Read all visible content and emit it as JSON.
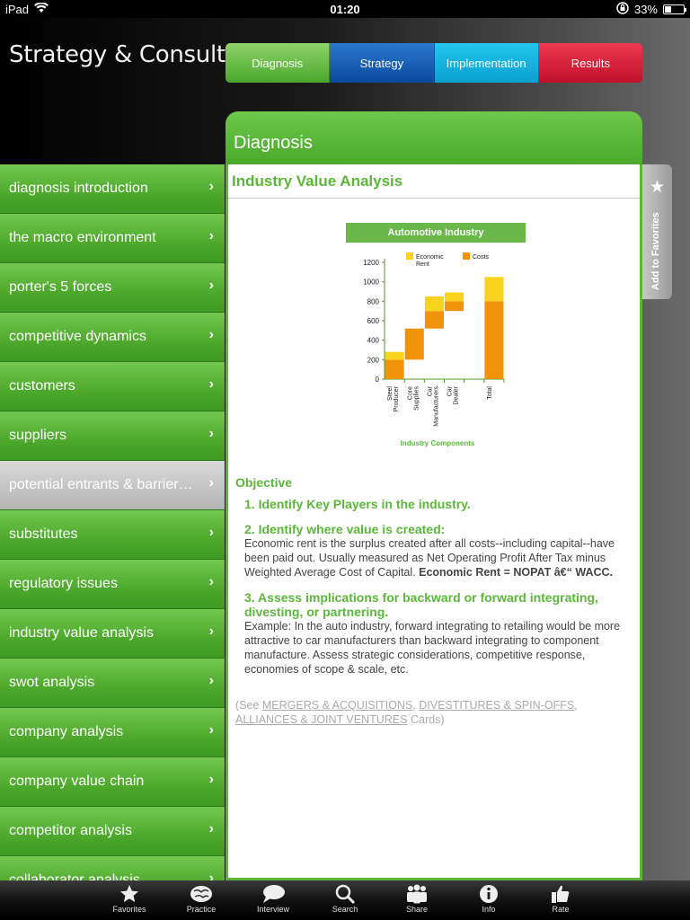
{
  "status": {
    "device": "iPad",
    "time": "01:20",
    "battery": "33%",
    "battery_fraction": 0.33
  },
  "header": {
    "title": "Strategy & Consulting"
  },
  "top_tabs": [
    {
      "label": "Diagnosis"
    },
    {
      "label": "Strategy"
    },
    {
      "label": "Implementation"
    },
    {
      "label": "Results"
    }
  ],
  "panel": {
    "title": "Diagnosis",
    "section_title": "Industry Value Analysis",
    "objective_heading": "Objective",
    "point1_title": "1. Identify Key Players in the industry.",
    "point2_title": "2. Identify where value is created:",
    "point2_text": "Economic rent is the surplus created after all costs--including capital--have been paid out. Usually measured as Net Operating Profit After Tax minus Weighted Average Cost of Capital.",
    "point2_bold": "Economic Rent = NOPAT â€“ WACC.",
    "point3_title": "3. Assess implications for backward or forward integrating, divesting, or partnering.",
    "point3_text": "Example: In the auto industry, forward integrating to retailing would be more attractive to car manufacturers than backward integrating to component manufacture. Assess strategic considerations, competitive response, economies of scope & scale, etc.",
    "see_prefix": "(See ",
    "link1": "MERGERS & ACQUISITIONS",
    "sep1": ", ",
    "link2": "DIVESTITURES & SPIN-OFFS",
    "sep2": ",",
    "link3": "ALLIANCES & JOINT VENTURES",
    "see_suffix": " Cards)"
  },
  "favorites_tab": {
    "label": "Add to Favorites"
  },
  "sidebar": {
    "items": [
      {
        "label": "diagnosis introduction"
      },
      {
        "label": "the macro environment"
      },
      {
        "label": "porter's 5 forces"
      },
      {
        "label": "competitive dynamics"
      },
      {
        "label": "customers"
      },
      {
        "label": "suppliers"
      },
      {
        "label": "potential entrants & barrier…"
      },
      {
        "label": "substitutes"
      },
      {
        "label": "regulatory issues"
      },
      {
        "label": "industry value analysis"
      },
      {
        "label": "swot analysis"
      },
      {
        "label": "company analysis"
      },
      {
        "label": "company value chain"
      },
      {
        "label": "competitor analysis"
      },
      {
        "label": "collaborator analysis"
      }
    ],
    "active_index": 6
  },
  "tab_bar": [
    {
      "label": "Favorites",
      "icon": "star-icon"
    },
    {
      "label": "Practice",
      "icon": "brain-icon"
    },
    {
      "label": "Interview",
      "icon": "speech-bubble-icon"
    },
    {
      "label": "Search",
      "icon": "search-icon"
    },
    {
      "label": "Share",
      "icon": "people-icon"
    },
    {
      "label": "Info",
      "icon": "info-icon"
    },
    {
      "label": "Rate",
      "icon": "thumbs-up-icon"
    }
  ],
  "chart_data": {
    "type": "bar",
    "title": "Automotive Industry",
    "xlabel": "Industry Components",
    "ylabel": "",
    "ylim": [
      0,
      1200
    ],
    "yticks": [
      0,
      200,
      400,
      600,
      800,
      1000,
      1200
    ],
    "categories": [
      "Steel Producer",
      "Core Supplies",
      "Car Manufacturers",
      "Car Dealer",
      "",
      "Total"
    ],
    "series": [
      {
        "name": "Costs",
        "color": "#f0920a",
        "base": [
          0,
          200,
          520,
          700,
          0,
          0
        ],
        "values": [
          200,
          320,
          180,
          100,
          0,
          800
        ]
      },
      {
        "name": "Economic Rent",
        "color": "#f8d21c",
        "base": [
          200,
          520,
          700,
          800,
          0,
          800
        ],
        "values": [
          80,
          0,
          150,
          90,
          0,
          250
        ]
      }
    ],
    "legend": "top"
  }
}
